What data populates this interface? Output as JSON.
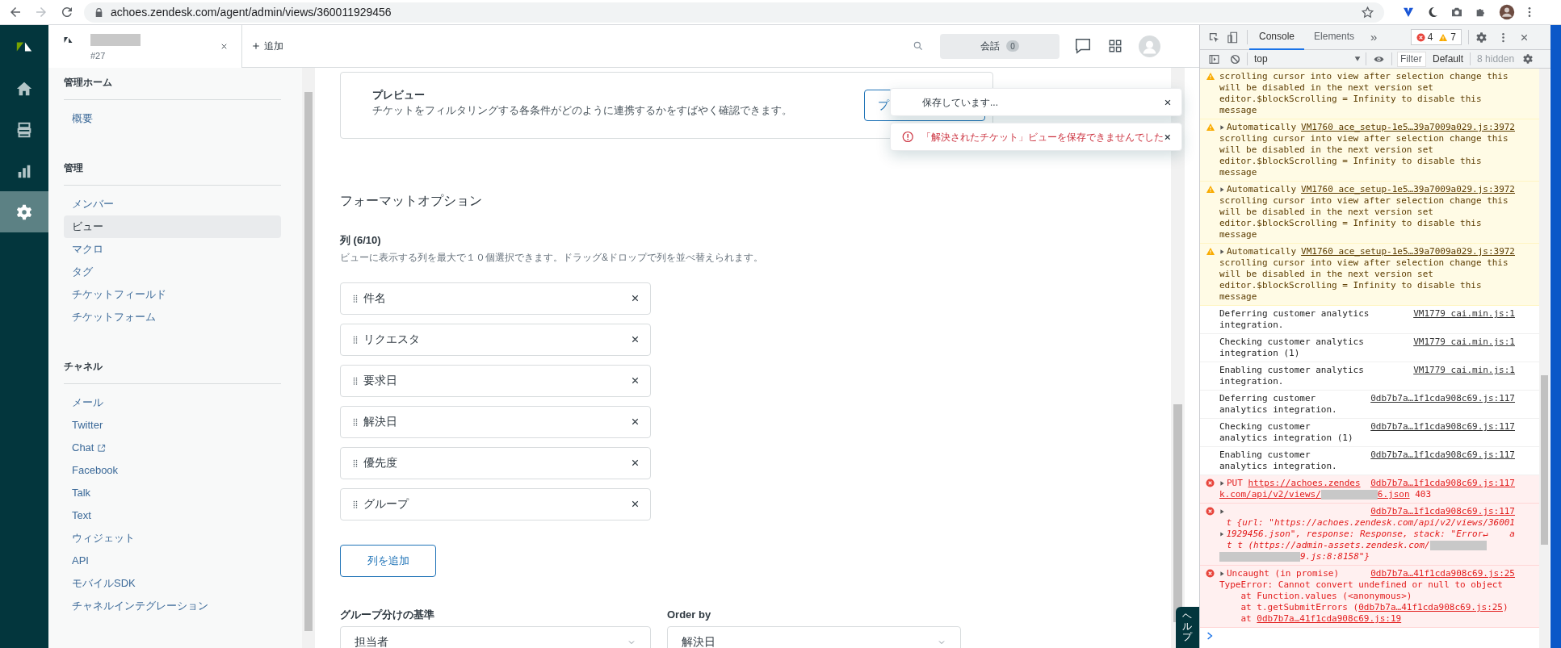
{
  "browser": {
    "nav_buttons": [
      {
        "kind": "back",
        "disabled": false
      },
      {
        "kind": "forward",
        "disabled": true
      },
      {
        "kind": "reload",
        "disabled": false
      }
    ],
    "url": "achoes.zendesk.com/agent/admin/views/360011929456"
  },
  "nav_rail": [
    {
      "kind": "home",
      "selected": false
    },
    {
      "kind": "views",
      "selected": false
    },
    {
      "kind": "reporting",
      "selected": false
    },
    {
      "kind": "settings",
      "selected": true
    }
  ],
  "app_header": {
    "tab_number": "#27",
    "add_label": "追加",
    "conversations_label": "会話",
    "conversations_count": "0"
  },
  "sidebar": {
    "sections": [
      {
        "heading": "管理ホーム",
        "items": [
          {
            "label": "概要",
            "selected": false,
            "external": false
          }
        ]
      },
      {
        "heading": "管理",
        "items": [
          {
            "label": "メンバー",
            "selected": false,
            "external": false
          },
          {
            "label": "ビュー",
            "selected": true,
            "external": false
          },
          {
            "label": "マクロ",
            "selected": false,
            "external": false
          },
          {
            "label": "タグ",
            "selected": false,
            "external": false
          },
          {
            "label": "チケットフィールド",
            "selected": false,
            "external": false
          },
          {
            "label": "チケットフォーム",
            "selected": false,
            "external": false
          }
        ]
      },
      {
        "heading": "チャネル",
        "items": [
          {
            "label": "メール",
            "selected": false,
            "external": false
          },
          {
            "label": "Twitter",
            "selected": false,
            "external": false
          },
          {
            "label": "Chat",
            "selected": false,
            "external": true
          },
          {
            "label": "Facebook",
            "selected": false,
            "external": false
          },
          {
            "label": "Talk",
            "selected": false,
            "external": false
          },
          {
            "label": "Text",
            "selected": false,
            "external": false
          },
          {
            "label": "ウィジェット",
            "selected": false,
            "external": false
          },
          {
            "label": "API",
            "selected": false,
            "external": false
          },
          {
            "label": "モバイルSDK",
            "selected": false,
            "external": false
          },
          {
            "label": "チャネルインテグレーション",
            "selected": false,
            "external": false
          }
        ]
      }
    ]
  },
  "preview_card": {
    "title": "プレビュー",
    "description": "チケットをフィルタリングする各条件がどのように連携するかをすばやく確認できます。",
    "button": "プ"
  },
  "toasts": [
    {
      "kind": "progress",
      "text": "保存しています..."
    },
    {
      "kind": "error",
      "text": "「解決されたチケット」ビューを保存できませんでした"
    }
  ],
  "format_options": {
    "heading": "フォーマットオプション",
    "columns_label": "列 (6/10)",
    "columns_help": "ビューに表示する列を最大で１０個選択できます。ドラッグ&ドロップで列を並べ替えられます。",
    "columns": [
      "件名",
      "リクエスタ",
      "要求日",
      "解決日",
      "優先度",
      "グループ"
    ],
    "add_button": "列を追加",
    "group_by": {
      "label": "グループ分けの基準",
      "value": "担当者"
    },
    "order_by": {
      "label": "Order by",
      "value": "解決日"
    }
  },
  "help_tab": "ヘルプ",
  "devtools": {
    "tabs": [
      {
        "label": "Console",
        "selected": true
      },
      {
        "label": "Elements",
        "selected": false
      }
    ],
    "more": "»",
    "error_count": "4",
    "warning_count": "7",
    "context": "top",
    "filter_placeholder": "Filter",
    "levels": "Default",
    "hidden_count": "8 hidden",
    "messages": [
      {
        "kind": "warning",
        "expandable": false,
        "lines": [
          [
            {
              "kind": "text",
              "text": "scrolling cursor into view after selection change this"
            }
          ],
          [
            {
              "kind": "text",
              "text": "will be disabled in the next version set"
            }
          ],
          [
            {
              "kind": "text",
              "text": "editor.$blockScrolling = Infinity to disable this"
            }
          ],
          [
            {
              "kind": "text",
              "text": "message"
            }
          ]
        ]
      },
      {
        "kind": "warning",
        "expandable": true,
        "first": [
          {
            "kind": "text",
            "text": "Automatically"
          }
        ],
        "source": "VM1760 ace_setup-1e5…39a7009a029.js:3972",
        "lines": [
          [
            {
              "kind": "text",
              "text": "scrolling cursor into view after selection change this"
            }
          ],
          [
            {
              "kind": "text",
              "text": "will be disabled in the next version set"
            }
          ],
          [
            {
              "kind": "text",
              "text": "editor.$blockScrolling = Infinity to disable this"
            }
          ],
          [
            {
              "kind": "text",
              "text": "message"
            }
          ]
        ]
      },
      {
        "kind": "warning",
        "expandable": true,
        "first": [
          {
            "kind": "text",
            "text": "Automatically"
          }
        ],
        "source": "VM1760 ace_setup-1e5…39a7009a029.js:3972",
        "lines": [
          [
            {
              "kind": "text",
              "text": "scrolling cursor into view after selection change this"
            }
          ],
          [
            {
              "kind": "text",
              "text": "will be disabled in the next version set"
            }
          ],
          [
            {
              "kind": "text",
              "text": "editor.$blockScrolling = Infinity to disable this"
            }
          ],
          [
            {
              "kind": "text",
              "text": "message"
            }
          ]
        ]
      },
      {
        "kind": "warning",
        "expandable": true,
        "first": [
          {
            "kind": "text",
            "text": "Automatically"
          }
        ],
        "source": "VM1760 ace_setup-1e5…39a7009a029.js:3972",
        "lines": [
          [
            {
              "kind": "text",
              "text": "scrolling cursor into view after selection change this"
            }
          ],
          [
            {
              "kind": "text",
              "text": "will be disabled in the next version set"
            }
          ],
          [
            {
              "kind": "text",
              "text": "editor.$blockScrolling = Infinity to disable this"
            }
          ],
          [
            {
              "kind": "text",
              "text": "message"
            }
          ]
        ]
      },
      {
        "kind": "info",
        "expandable": false,
        "first": [
          {
            "kind": "text",
            "text": "Deferring customer analytics"
          }
        ],
        "source": "VM1779 cai.min.js:1",
        "lines": [
          [
            {
              "kind": "text",
              "text": "integration."
            }
          ]
        ]
      },
      {
        "kind": "info",
        "expandable": false,
        "first": [
          {
            "kind": "text",
            "text": "Checking customer analytics"
          }
        ],
        "source": "VM1779 cai.min.js:1",
        "lines": [
          [
            {
              "kind": "text",
              "text": "integration (1)"
            }
          ]
        ]
      },
      {
        "kind": "info",
        "expandable": false,
        "first": [
          {
            "kind": "text",
            "text": "Enabling customer analytics"
          }
        ],
        "source": "VM1779 cai.min.js:1",
        "lines": [
          [
            {
              "kind": "text",
              "text": "integration."
            }
          ]
        ]
      },
      {
        "kind": "info",
        "expandable": false,
        "first": [
          {
            "kind": "text",
            "text": "Deferring customer"
          }
        ],
        "source": "0db7b7a…1f1cda908c69.js:117",
        "lines": [
          [
            {
              "kind": "text",
              "text": "analytics integration."
            }
          ]
        ]
      },
      {
        "kind": "info",
        "expandable": false,
        "first": [
          {
            "kind": "text",
            "text": "Checking customer"
          }
        ],
        "source": "0db7b7a…1f1cda908c69.js:117",
        "lines": [
          [
            {
              "kind": "text",
              "text": "analytics integration (1)"
            }
          ]
        ]
      },
      {
        "kind": "info",
        "expandable": false,
        "first": [
          {
            "kind": "text",
            "text": "Enabling customer"
          }
        ],
        "source": "0db7b7a…1f1cda908c69.js:117",
        "lines": [
          [
            {
              "kind": "text",
              "text": "analytics integration."
            }
          ]
        ]
      },
      {
        "kind": "error",
        "expandable": true,
        "first": [
          {
            "kind": "text",
            "text": "PUT "
          },
          {
            "kind": "link",
            "text": "https://achoes.zendes"
          }
        ],
        "source": "0db7b7a…1f1cda908c69.js:117",
        "lines": [
          [
            {
              "kind": "link",
              "text": "k.com/api/v2/views/"
            },
            {
              "kind": "redacted"
            },
            {
              "kind": "link",
              "text": "6.json"
            },
            {
              "kind": "text",
              "text": " 403"
            }
          ]
        ]
      },
      {
        "kind": "error",
        "expandable": true,
        "source": "0db7b7a…1f1cda908c69.js:117",
        "lines": [
          [
            {
              "kind": "indent"
            },
            {
              "kind": "italic",
              "text": "t {url: \"https://achoes.zendesk.com/api/v2/views/36001"
            }
          ],
          [
            {
              "kind": "arrow"
            },
            {
              "kind": "italic",
              "text": "1929456.json\", response: Response, stack: \"Error↵    a"
            }
          ],
          [
            {
              "kind": "indent"
            },
            {
              "kind": "italic",
              "text": "t t (https://admin-assets.zendesk.com/"
            },
            {
              "kind": "redacted"
            }
          ],
          [
            {
              "kind": "redacted"
            },
            {
              "kind": "italic",
              "text": "9.js:8:8158\"}"
            }
          ]
        ]
      },
      {
        "kind": "error",
        "expandable": true,
        "first": [
          {
            "kind": "text",
            "text": "Uncaught (in promise)"
          }
        ],
        "source": "0db7b7a…41f1cda908c69.js:25",
        "lines": [
          [
            {
              "kind": "text",
              "text": "TypeError: Cannot convert undefined or null to object"
            }
          ],
          [
            {
              "kind": "text",
              "text": "    at Function.values (<anonymous>)"
            }
          ],
          [
            {
              "kind": "text",
              "text": "    at t.getSubmitErrors ("
            },
            {
              "kind": "link",
              "text": "0db7b7a…41f1cda908c69.js:25"
            },
            {
              "kind": "text",
              "text": ")"
            }
          ],
          [
            {
              "kind": "text",
              "text": "    at "
            },
            {
              "kind": "link",
              "text": "0db7b7a…41f1cda908c69.js:19"
            }
          ]
        ]
      }
    ]
  }
}
